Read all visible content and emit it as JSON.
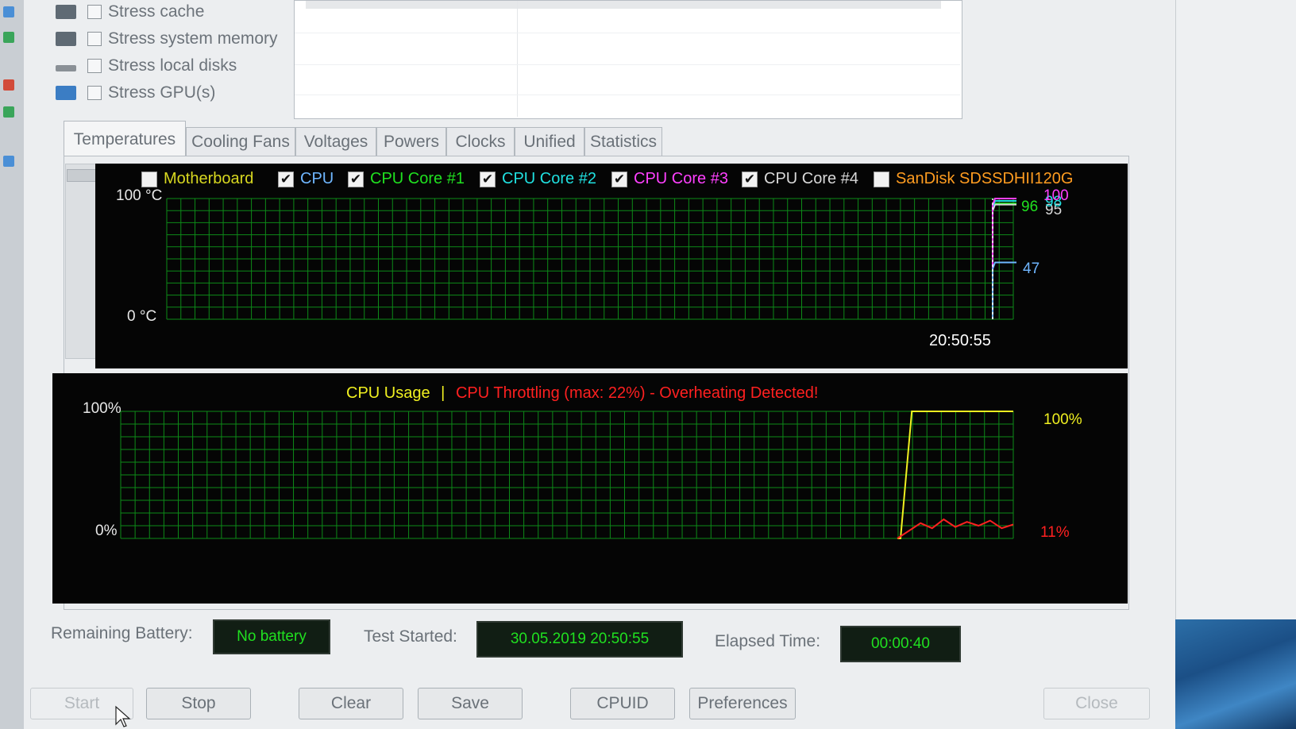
{
  "stress_options": [
    {
      "label": "Stress cache",
      "checked": false,
      "icon": "cache-icon"
    },
    {
      "label": "Stress system memory",
      "checked": false,
      "icon": "memory-icon"
    },
    {
      "label": "Stress local disks",
      "checked": false,
      "icon": "disk-icon"
    },
    {
      "label": "Stress GPU(s)",
      "checked": false,
      "icon": "gpu-icon"
    }
  ],
  "tabs": [
    "Temperatures",
    "Cooling Fans",
    "Voltages",
    "Powers",
    "Clocks",
    "Unified",
    "Statistics"
  ],
  "active_tab": "Temperatures",
  "temperature_graph": {
    "legend": [
      {
        "label": "Motherboard",
        "checked": false,
        "color": "#d8d820"
      },
      {
        "label": "CPU",
        "checked": true,
        "color": "#6fb6ff"
      },
      {
        "label": "CPU Core #1",
        "checked": true,
        "color": "#20e020"
      },
      {
        "label": "CPU Core #2",
        "checked": true,
        "color": "#20e0e0"
      },
      {
        "label": "CPU Core #3",
        "checked": true,
        "color": "#ff40ff"
      },
      {
        "label": "CPU Core #4",
        "checked": true,
        "color": "#d8d8d8"
      },
      {
        "label": "SanDisk SDSSDHII120G",
        "checked": false,
        "color": "#ff9c20"
      }
    ],
    "y_top_label": "100 °C",
    "y_bottom_label": "0 °C",
    "time_label": "20:50:55",
    "readouts": [
      {
        "text": "96",
        "color": "#20e020"
      },
      {
        "text": "95",
        "color": "#d8d8d8"
      },
      {
        "text": "98",
        "color": "#20e0e0"
      },
      {
        "text": "100",
        "color": "#ff40ff"
      },
      {
        "text": "47",
        "color": "#6fb6ff"
      }
    ]
  },
  "cpu_graph": {
    "title_usage": "CPU Usage",
    "separator": "|",
    "title_throttle": "CPU Throttling (max: 22%) - Overheating Detected!",
    "y_top_label": "100%",
    "y_bottom_label": "0%",
    "usage_readout": "100%",
    "throttle_readout": "11%",
    "usage_color": "#f0f020",
    "throttle_color": "#ff2020"
  },
  "status_bar": {
    "battery_label": "Remaining Battery:",
    "battery_value": "No battery",
    "test_started_label": "Test Started:",
    "test_started_value": "30.05.2019 20:50:55",
    "elapsed_label": "Elapsed Time:",
    "elapsed_value": "00:00:40"
  },
  "buttons": {
    "start": "Start",
    "stop": "Stop",
    "clear": "Clear",
    "save": "Save",
    "cpuid": "CPUID",
    "preferences": "Preferences",
    "close": "Close"
  },
  "chart_data": [
    {
      "type": "line",
      "title": "",
      "ylabel": "°C",
      "ylim": [
        0,
        100
      ],
      "x_end_label": "20:50:55",
      "series": [
        {
          "name": "CPU Core #1",
          "last_value": 96
        },
        {
          "name": "CPU Core #4",
          "last_value": 95
        },
        {
          "name": "CPU Core #2",
          "last_value": 98
        },
        {
          "name": "CPU Core #3",
          "last_value": 100
        },
        {
          "name": "CPU",
          "last_value": 47
        }
      ]
    },
    {
      "type": "line",
      "title": "CPU Usage | CPU Throttling (max: 22%) - Overheating Detected!",
      "ylim": [
        0,
        100
      ],
      "series": [
        {
          "name": "CPU Usage",
          "values": [
            0,
            100,
            100,
            100,
            100,
            100,
            100,
            100,
            100,
            100,
            100
          ],
          "last_value": 100
        },
        {
          "name": "CPU Throttling",
          "values": [
            0,
            6,
            12,
            8,
            15,
            9,
            13,
            10,
            14,
            8,
            11
          ],
          "last_value": 11
        }
      ]
    }
  ]
}
